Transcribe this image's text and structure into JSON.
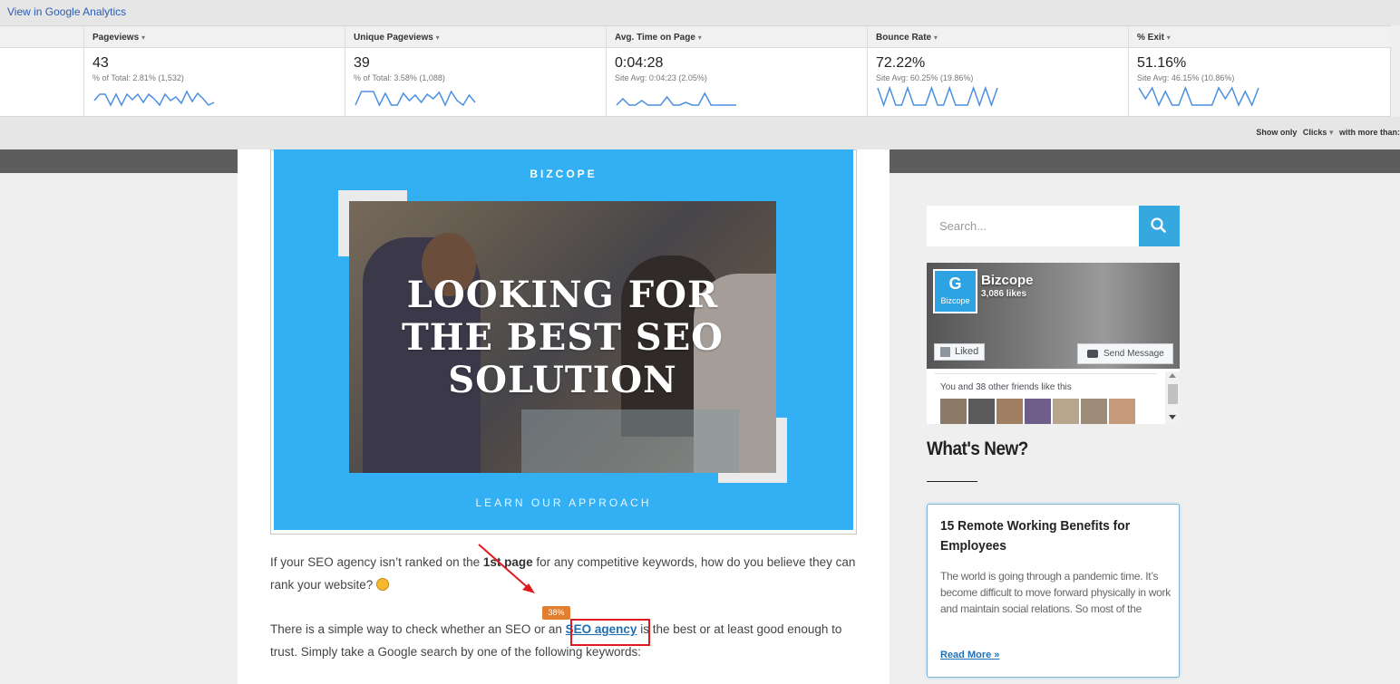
{
  "analytics": {
    "link_label": "View in Google Analytics",
    "metrics": [
      {
        "name": "Pageviews",
        "value": "43",
        "sub": "% of Total: 2.81% (1,532)",
        "spark": [
          8,
          15,
          15,
          3,
          15,
          3,
          15,
          9,
          15,
          6,
          15,
          10,
          3,
          15,
          8,
          12,
          5,
          18,
          7,
          16,
          10,
          3,
          6
        ]
      },
      {
        "name": "Unique Pageviews",
        "value": "39",
        "sub": "% of Total: 3.58% (1,088)",
        "spark": [
          3,
          18,
          18,
          18,
          3,
          16,
          3,
          3,
          16,
          8,
          14,
          6,
          15,
          10,
          17,
          3,
          18,
          8,
          3,
          14,
          6
        ]
      },
      {
        "name": "Avg. Time on Page",
        "value": "0:04:28",
        "sub": "Site Avg: 0:04:23 (2.05%)",
        "spark": [
          3,
          10,
          3,
          3,
          8,
          3,
          3,
          3,
          12,
          3,
          3,
          6,
          3,
          3,
          16,
          3,
          3,
          3,
          3,
          3
        ]
      },
      {
        "name": "Bounce Rate",
        "value": "72.22%",
        "sub": "Site Avg: 60.25% (19.86%)",
        "spark": [
          22,
          3,
          22,
          3,
          3,
          22,
          3,
          3,
          3,
          22,
          3,
          3,
          22,
          3,
          3,
          3,
          22,
          3,
          22,
          3,
          22
        ]
      },
      {
        "name": "% Exit",
        "value": "51.16%",
        "sub": "Site Avg: 46.15% (10.86%)",
        "spark": [
          22,
          10,
          22,
          3,
          18,
          3,
          3,
          22,
          3,
          3,
          3,
          3,
          22,
          10,
          22,
          3,
          18,
          3,
          22
        ]
      }
    ],
    "filter": {
      "show_only": "Show only",
      "clicks": "Clicks",
      "more_than": "with more than:"
    }
  },
  "hero": {
    "brand": "BIZCOPE",
    "headline_lines": [
      "LOOKING FOR",
      "THE BEST SEO",
      "SOLUTION"
    ],
    "cta": "LEARN OUR APPROACH"
  },
  "article": {
    "p1_before": "If your SEO agency isn’t ranked on the ",
    "p1_bold": "1st page",
    "p1_after": " for any competitive keywords, how do you believe they can rank your website? ",
    "p2_before": "There is a simple way to check whether an SEO or an ",
    "p2_link": "SEO agency",
    "p2_after": " is the best or at least good enough to trust. Simply take a Google search by one of the following keywords:",
    "click_badge": "38%"
  },
  "sidebar": {
    "search_placeholder": "Search...",
    "facebook": {
      "logo_text": "Bizcope",
      "page_name": "Bizcope",
      "likes": "3,086 likes",
      "liked_label": "Liked",
      "send_label": "Send Message",
      "friends_text": "You and 38 other friends like this"
    },
    "whats_new_title": "What's New?",
    "post": {
      "title": "15 Remote Working Benefits for Employees",
      "excerpt": "The world is going through a pandemic time. It’s become difficult to move forward physically in work and maintain social relations. So most of the",
      "read_more": "Read More »"
    }
  },
  "colors": {
    "accent": "#35a8e0",
    "hero_bg": "#33b0f3",
    "highlight": "#e0191e",
    "badge": "#e27e30",
    "link": "#1f6fb2"
  }
}
